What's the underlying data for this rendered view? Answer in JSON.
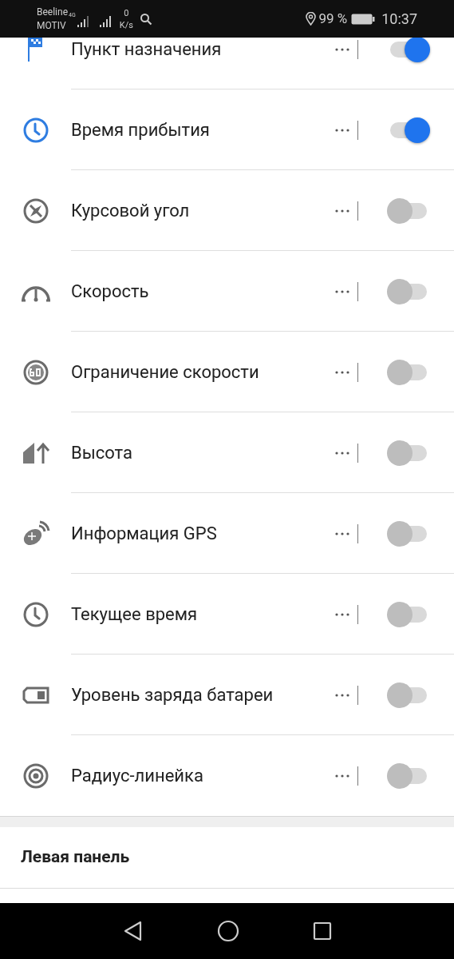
{
  "status_bar": {
    "carrier_top": "Beeline",
    "carrier_bottom": "MOTIV",
    "network": "4G",
    "speed_value": "0",
    "speed_unit": "K/s",
    "battery": "99 %",
    "time": "10:37"
  },
  "widgets": [
    {
      "label": "Пункт назначения",
      "kind": "flag",
      "on": true
    },
    {
      "label": "Время прибытия",
      "kind": "clock",
      "on": true
    },
    {
      "label": "Курсовой угол",
      "kind": "compass",
      "on": false
    },
    {
      "label": "Скорость",
      "kind": "speedometer",
      "on": false
    },
    {
      "label": "Ограничение скорости",
      "kind": "limit",
      "on": false
    },
    {
      "label": "Высота",
      "kind": "altitude",
      "on": false
    },
    {
      "label": "Информация GPS",
      "kind": "satellite",
      "on": false
    },
    {
      "label": "Текущее время",
      "kind": "clock",
      "on": false
    },
    {
      "label": "Уровень заряда батареи",
      "kind": "battery",
      "on": false
    },
    {
      "label": "Радиус-линейка",
      "kind": "target",
      "on": false
    }
  ],
  "section": {
    "title": "Левая панель"
  }
}
